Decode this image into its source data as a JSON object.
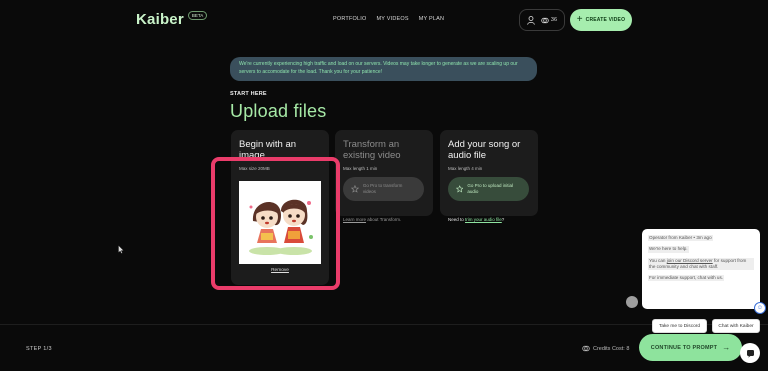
{
  "header": {
    "logo": "Kaiber",
    "beta": "BETA",
    "nav": [
      "PORTFOLIO",
      "MY VIDEOS",
      "MY PLAN"
    ],
    "credits": "36",
    "create_label": "CREATE VIDEO"
  },
  "notice": "We're currently experiencing high traffic and load on our servers. Videos may take longer to generate as we are scaling up our servers to accomodate for the load. Thank you for your patience!",
  "section_label": "START HERE",
  "page_title": "Upload files",
  "cards": [
    {
      "title": "Begin with an image",
      "sub": "Max size 20MB",
      "remove": "Remove"
    },
    {
      "title": "Transform an existing video",
      "sub": "Max length 1 min",
      "pill": "Go Pro to transform videos",
      "link_prefix": "",
      "link": "Learn more",
      "link_suffix": " about Transform."
    },
    {
      "title": "Add your song or audio file",
      "sub": "Max length 4 min",
      "pill": "Go Pro to upload initial audio",
      "link_prefix": "Need to ",
      "link": "trim your audio file",
      "link_suffix": "?"
    }
  ],
  "footer": {
    "step": "STEP 1/3",
    "cost": "Credits Cost: 8",
    "continue": "CONTINUE TO PROMPT"
  },
  "chat": {
    "operator": "Operator from Kaiber",
    "time": " • 3m ago",
    "line1": "We're here to help.",
    "line2_prefix": "You can ",
    "line2_link": "join our Discord server",
    "line2_suffix": " for support from the community and chat with staff.",
    "line3": "For immediate support, chat with us.",
    "btn_discord": "Take me to Discord",
    "btn_chat": "Chat with Kaiber"
  },
  "colors": {
    "accent": "#a6edae",
    "title": "#a6e9a6",
    "highlight": "#ea3c6a",
    "notice_bg": "#3a4f5c"
  }
}
